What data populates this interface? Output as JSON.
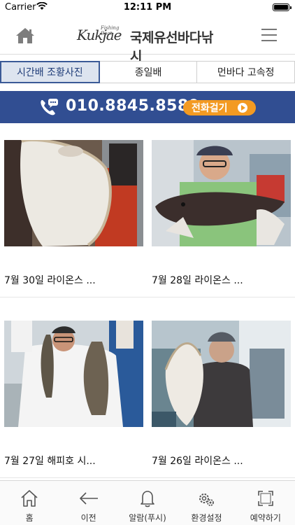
{
  "status_bar": {
    "carrier": "Carrier",
    "time": "12:11 PM"
  },
  "header": {
    "logo_small": "Fishing Boat",
    "logo_script": "Kukjae",
    "title": "국제유선바다낚시"
  },
  "tabs": [
    {
      "label": "시간배 조황사진",
      "active": true
    },
    {
      "label": "종일배",
      "active": false
    },
    {
      "label": "먼바다 고속정",
      "active": false
    }
  ],
  "banner": {
    "phone_number": "010.8845.8589",
    "call_label": "전화걸기"
  },
  "posts": [
    {
      "caption": "7월 30일 라이온스 ...",
      "photo": "angler-holding-flounder"
    },
    {
      "caption": "7월 28일 라이온스 ...",
      "photo": "angler-holding-rockfish"
    },
    {
      "caption": "7월 27일 해피호 시...",
      "photo": "angler-holding-two-rockfish"
    },
    {
      "caption": "7월 26일 라이온스 ...",
      "photo": "angler-holding-flounder-on-boat"
    }
  ],
  "tabbar": [
    {
      "label": "홈",
      "icon": "home-icon"
    },
    {
      "label": "이전",
      "icon": "back-arrow-icon"
    },
    {
      "label": "알람(푸시)",
      "icon": "bell-icon"
    },
    {
      "label": "환경설정",
      "icon": "gears-icon"
    },
    {
      "label": "예약하기",
      "icon": "expand-frame-icon"
    }
  ],
  "colors": {
    "brand_blue": "#314e92",
    "call_orange": "#f39a22",
    "active_tab_border": "#3b5a97"
  }
}
